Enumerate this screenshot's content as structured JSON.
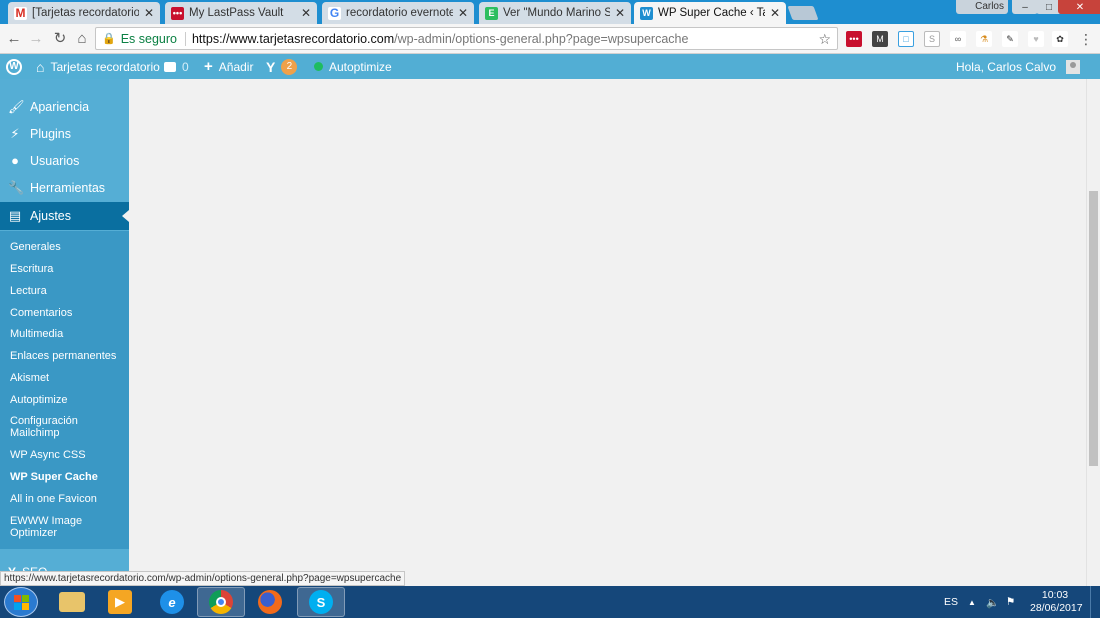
{
  "browser": {
    "tabs": [
      {
        "title": "[Tarjetas recordatorio] N",
        "favicon": "gmail-icon",
        "favicon_color": "#d93025",
        "active": false
      },
      {
        "title": "My LastPass Vault",
        "favicon": "lastpass-icon",
        "favicon_color": "#c8102e",
        "active": false
      },
      {
        "title": "recordatorio evernote de",
        "favicon": "google-icon",
        "favicon_color": "#4285f4",
        "active": false
      },
      {
        "title": "Ver \"Mundo Marino Sho",
        "favicon": "evernote-icon",
        "favicon_color": "#2dbe60",
        "active": false
      },
      {
        "title": "WP Super Cache ‹ Tarjeta",
        "favicon": "wpsupercache-icon",
        "favicon_color": "#1e8ed0",
        "active": true
      }
    ],
    "close_glyph": "✕",
    "window_user": "Carlos",
    "address": {
      "secure_label": "Es seguro",
      "url_host": "https://www.tarjetasrecordatorio.com",
      "url_path": "/wp-admin/options-general.php?page=wpsupercache"
    },
    "status_url": "https://www.tarjetasrecordatorio.com/wp-admin/options-general.php?page=wpsupercache"
  },
  "adminbar": {
    "site_name": "Tarjetas recordatorio",
    "comments_count": "0",
    "new_label": "Añadir",
    "yoast_count": "2",
    "autoptimize_label": "Autoptimize",
    "greeting": "Hola, Carlos Calvo"
  },
  "sidebar": {
    "top_items": [
      {
        "label": "Apariencia",
        "icon": "brush-icon"
      },
      {
        "label": "Plugins",
        "icon": "plugin-icon"
      },
      {
        "label": "Usuarios",
        "icon": "user-icon"
      },
      {
        "label": "Herramientas",
        "icon": "wrench-icon"
      },
      {
        "label": "Ajustes",
        "icon": "settings-icon",
        "current": true
      }
    ],
    "submenu": [
      "Generales",
      "Escritura",
      "Lectura",
      "Comentarios",
      "Multimedia",
      "Enlaces permanentes",
      "Akismet",
      "Autoptimize",
      "Configuración Mailchimp",
      "WP Async CSS",
      "WP Super Cache",
      "All in one Favicon",
      "EWWW Image Optimizer"
    ],
    "submenu_current": "WP Super Cache",
    "seo_label": "SEO"
  },
  "taskbar": {
    "apps": [
      "explorer-icon",
      "media-player-icon",
      "ie-icon",
      "chrome-icon",
      "firefox-icon",
      "skype-icon"
    ],
    "language": "ES",
    "time": "10:03",
    "date": "28/06/2017"
  },
  "colors": {
    "adminbar": "#52aed4",
    "sidebar": "#55aed5",
    "submenu": "#3a98c5",
    "current": "#0a6fa0",
    "tabstrip": "#1e8ed0"
  }
}
